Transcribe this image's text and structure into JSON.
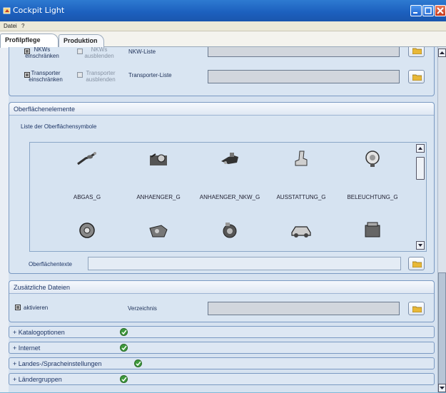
{
  "window": {
    "title": "Cockpit Light"
  },
  "menu": {
    "items": [
      "Datei",
      "?"
    ]
  },
  "tabs": [
    {
      "label": "Profilpflege",
      "active": true
    },
    {
      "label": "Produktion",
      "active": false
    }
  ],
  "top_section": {
    "rows": [
      {
        "cb1": "NKWs einschränken",
        "cb1_line1": "NKWs",
        "cb1_line2": "einschränken",
        "cb2_line1": "NKWs",
        "cb2_line2": "ausblenden",
        "list_label": "NKW-Liste"
      },
      {
        "cb1_line1": "Transporter",
        "cb1_line2": "einschränken",
        "cb2_line1": "Transporter",
        "cb2_line2": "ausblenden",
        "list_label": "Transporter-Liste"
      }
    ]
  },
  "oberflaechen": {
    "header": "Oberflächenelemente",
    "list_label": "Liste der Oberflächensymbole",
    "symbols_row1": [
      {
        "name": "ABGAS_G",
        "icon": "exhaust-icon"
      },
      {
        "name": "ANHAENGER_G",
        "icon": "trailer-hitch-icon"
      },
      {
        "name": "ANHAENGER_NKW_G",
        "icon": "truck-hitch-icon"
      },
      {
        "name": "AUSSTATTUNG_G",
        "icon": "car-seat-icon"
      },
      {
        "name": "BELEUCHTUNG_G",
        "icon": "lamp-icon"
      }
    ],
    "symbols_row2": [
      {
        "icon": "brake-disc-icon"
      },
      {
        "icon": "engine-block-icon"
      },
      {
        "icon": "clutch-icon"
      },
      {
        "icon": "car-body-icon"
      },
      {
        "icon": "engine-icon"
      }
    ],
    "texts_label": "Oberflächentexte"
  },
  "zusatz": {
    "header": "Zusätzliche Dateien",
    "checkbox_label": "aktivieren",
    "dir_label": "Verzeichnis"
  },
  "collapsed_sections": [
    {
      "label": "+ Katalogoptionen",
      "status": "ok"
    },
    {
      "label": "+ Internet",
      "status": "ok"
    },
    {
      "label": "+ Landes-/Spracheinstellungen",
      "status": "ok"
    },
    {
      "label": "+ Ländergruppen",
      "status": "ok"
    }
  ],
  "colors": {
    "titlebar": "#1c5fbd",
    "panel": "#d9e5f2",
    "ok": "#3e9a3c"
  }
}
